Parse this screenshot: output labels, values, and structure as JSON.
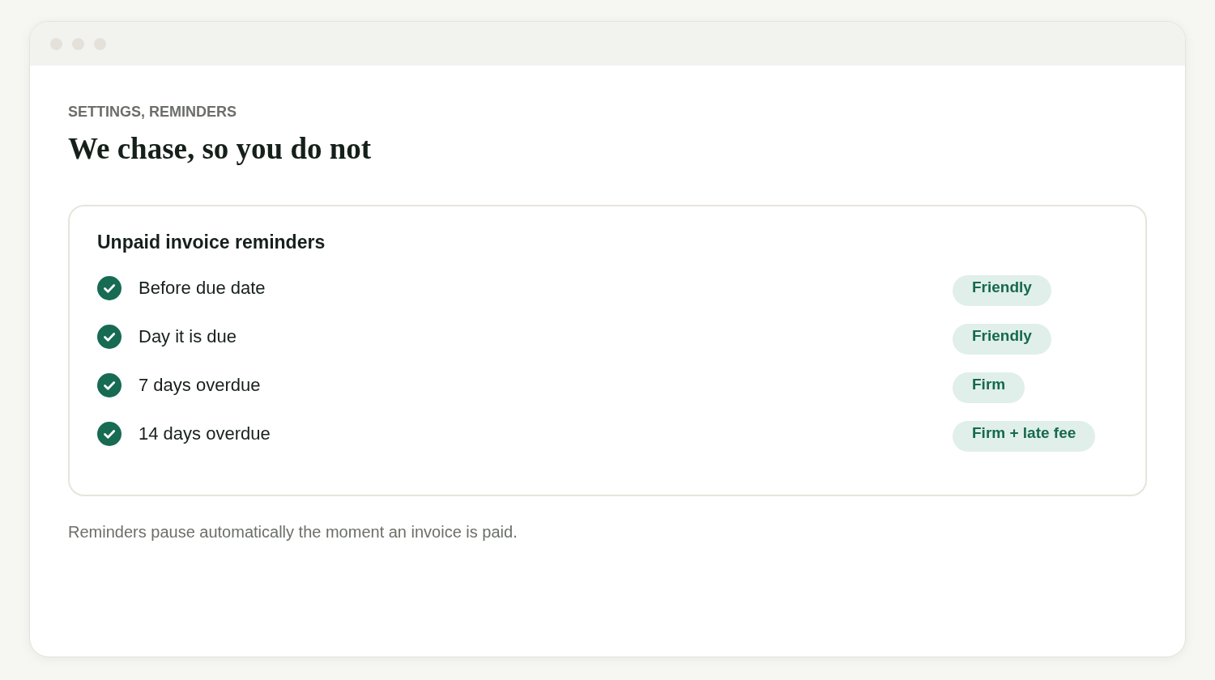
{
  "page": {
    "eyebrow": "SETTINGS, REMINDERS",
    "heading": "We chase, so you do not"
  },
  "card": {
    "title": "Unpaid invoice reminders",
    "rows": [
      {
        "label": "Before due date",
        "checked": true,
        "tone": "Friendly"
      },
      {
        "label": "Day it is due",
        "checked": true,
        "tone": "Friendly"
      },
      {
        "label": "7 days overdue",
        "checked": true,
        "tone": "Firm"
      },
      {
        "label": "14 days overdue",
        "checked": true,
        "tone": "Firm + late fee"
      }
    ]
  },
  "note": "Reminders pause automatically the moment an invoice is paid."
}
